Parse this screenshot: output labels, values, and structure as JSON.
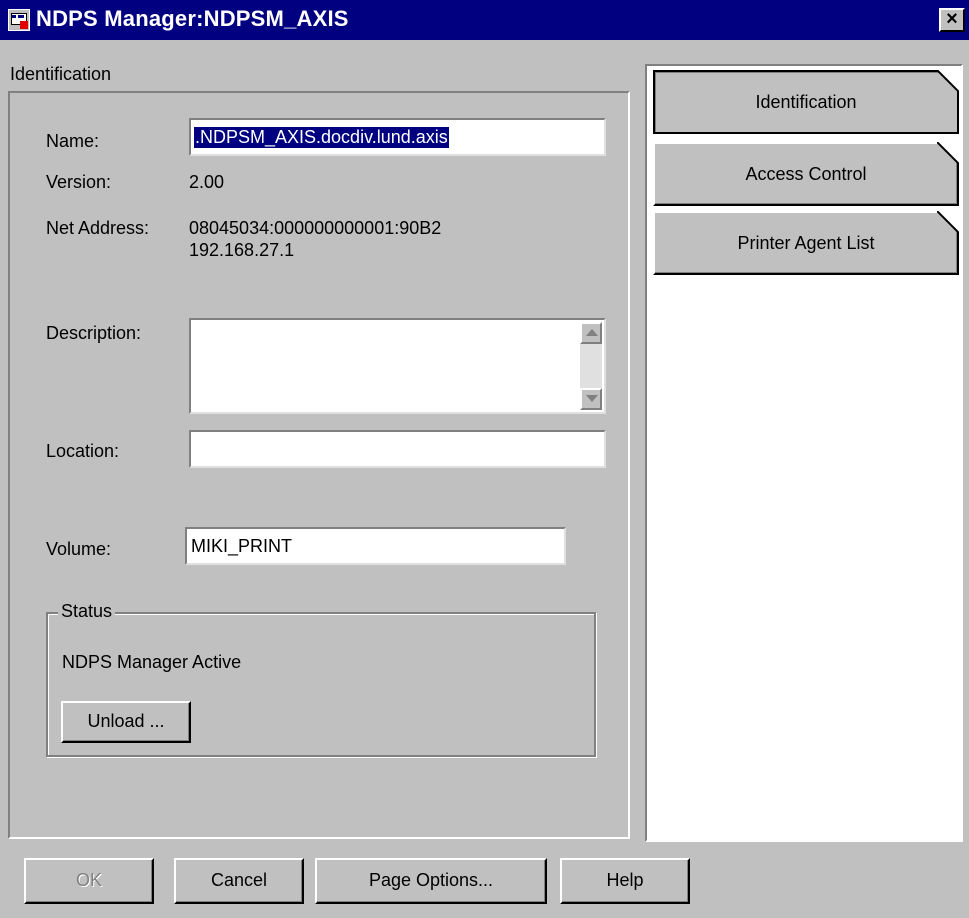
{
  "window": {
    "title": "NDPS Manager:NDPSM_AXIS",
    "close_glyph": "×"
  },
  "panel": {
    "title": "Identification"
  },
  "fields": {
    "name_label": "Name:",
    "name_value": ".NDPSM_AXIS.docdiv.lund.axis",
    "version_label": "Version:",
    "version_value": "2.00",
    "net_address_label": "Net Address:",
    "net_address_line1": "08045034:000000000001:90B2",
    "net_address_line2": "192.168.27.1",
    "description_label": "Description:",
    "description_value": "",
    "location_label": "Location:",
    "location_value": "",
    "volume_label": "Volume:",
    "volume_value": "MIKI_PRINT"
  },
  "status": {
    "legend": "Status",
    "text": "NDPS Manager Active",
    "unload_label": "Unload ..."
  },
  "pages": [
    {
      "label": "Identification",
      "active": true
    },
    {
      "label": "Access Control",
      "active": false
    },
    {
      "label": "Printer Agent List",
      "active": false
    }
  ],
  "buttons": {
    "ok": "OK",
    "cancel": "Cancel",
    "page_options": "Page Options...",
    "help": "Help"
  },
  "colors": {
    "title_bar": "#000080",
    "face": "#c0c0c0",
    "selection": "#000080"
  },
  "icons": [
    "app-icon",
    "close-icon",
    "scroll-up-icon",
    "scroll-down-icon",
    "page-corner-icon"
  ]
}
